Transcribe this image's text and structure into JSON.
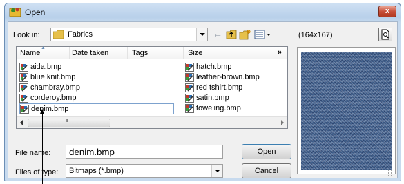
{
  "window": {
    "title": "Open",
    "close_label": "x"
  },
  "toolbar": {
    "look_in_label": "Look in:",
    "look_in_value": "Fabrics",
    "back_glyph": "←"
  },
  "preview": {
    "size_text": "(164x167)"
  },
  "columns": [
    "Name",
    "Date taken",
    "Tags",
    "Size"
  ],
  "more_columns": "»",
  "files_left": [
    "aida.bmp",
    "blue knit.bmp",
    "chambray.bmp",
    "corderoy.bmp",
    "denim.bmp"
  ],
  "files_right": [
    "hatch.bmp",
    "leather-brown.bmp",
    "red tshirt.bmp",
    "satin.bmp",
    "toweling.bmp"
  ],
  "selected_file": "denim.bmp",
  "form": {
    "file_name_label": "File name:",
    "file_name_value": "denim.bmp",
    "files_of_type_label": "Files of type:",
    "files_of_type_value": "Bitmaps (*.bmp)"
  },
  "buttons": {
    "open": "Open",
    "cancel": "Cancel"
  },
  "colors": {
    "title_gradient_top": "#cfe0f3",
    "close_red": "#c8503a",
    "selection_border": "#7da2ce",
    "denim": "#3b5a86"
  }
}
